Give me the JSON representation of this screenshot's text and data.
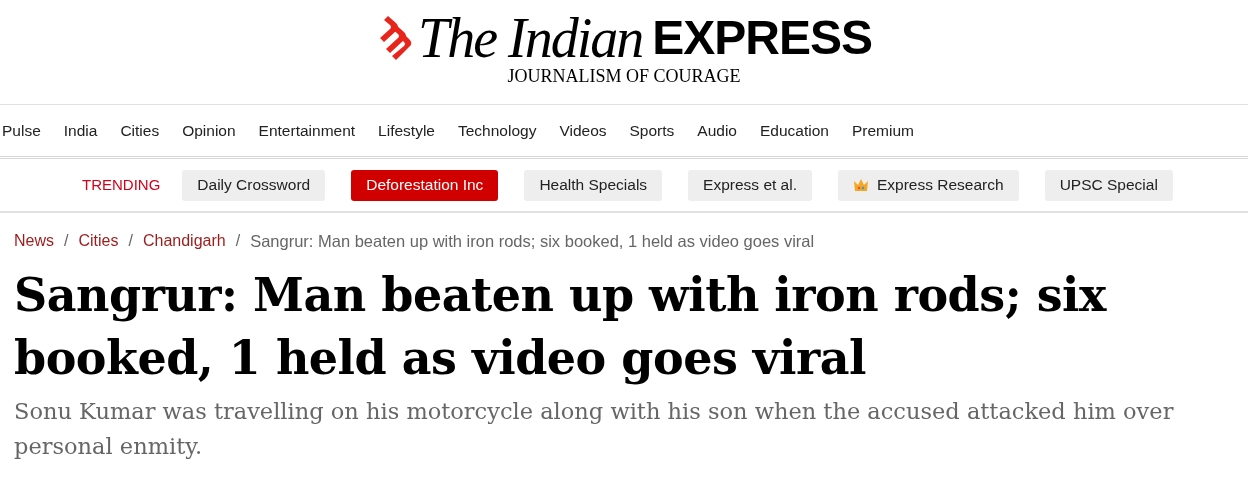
{
  "logo": {
    "name_italic": "The Indian",
    "name_bold": "EXPRESS",
    "tagline": "JOURNALISM OF COURAGE"
  },
  "nav": [
    "Pulse",
    "India",
    "Cities",
    "Opinion",
    "Entertainment",
    "Lifestyle",
    "Technology",
    "Videos",
    "Sports",
    "Audio",
    "Education",
    "Premium"
  ],
  "trending": {
    "label": "TRENDING",
    "items": [
      {
        "label": "Daily Crossword",
        "selected": false,
        "premium": false
      },
      {
        "label": "Deforestation Inc",
        "selected": true,
        "premium": false
      },
      {
        "label": "Health Specials",
        "selected": false,
        "premium": false
      },
      {
        "label": "Express et al.",
        "selected": false,
        "premium": false
      },
      {
        "label": "Express Research",
        "selected": false,
        "premium": true
      },
      {
        "label": "UPSC Special",
        "selected": false,
        "premium": false
      }
    ]
  },
  "breadcrumb": {
    "separator": "/",
    "links": [
      "News",
      "Cities",
      "Chandigarh"
    ],
    "current": "Sangrur: Man beaten up with iron rods; six booked, 1 held as video goes viral"
  },
  "article": {
    "headline": "Sangrur: Man beaten up with iron rods; six booked, 1 held as video goes viral",
    "summary": "Sonu Kumar was travelling on his motorcycle along with his son when the accused attacked him over personal enmity."
  }
}
